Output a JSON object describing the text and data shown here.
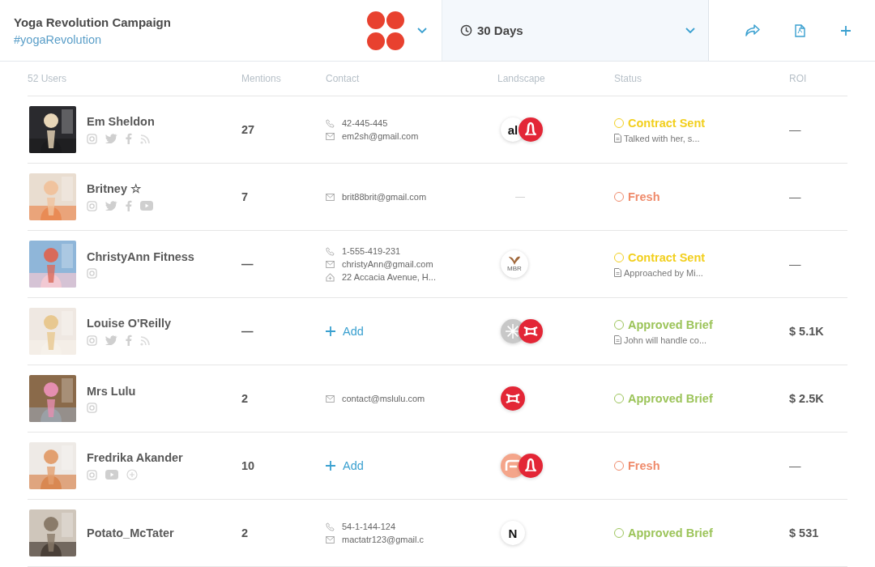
{
  "header": {
    "title": "Yoga Revolution Campaign",
    "hashtag": "#yogaRevolution",
    "date_range": "30 Days"
  },
  "columns": [
    "52 Users",
    "Mentions",
    "Contact",
    "Landscape",
    "Status",
    "ROI"
  ],
  "rows": [
    {
      "name": "Em Sheldon",
      "socials": [
        {
          "kind": "instagram"
        },
        {
          "kind": "twitter"
        },
        {
          "kind": "facebook"
        },
        {
          "kind": "rss"
        }
      ],
      "mentions": "27",
      "contact": [
        {
          "kind": "phone",
          "text": "42-445-445"
        },
        {
          "kind": "email",
          "text": "em2sh@gmail.com"
        }
      ],
      "brands": [
        {
          "kind": "wordmark",
          "text": "al"
        },
        {
          "kind": "lulu"
        }
      ],
      "status": {
        "kind": "contract",
        "label": "Contract Sent",
        "note": "Talked with her, s..."
      },
      "roi": "—"
    },
    {
      "name": "Britney ☆",
      "socials": [
        {
          "kind": "instagram"
        },
        {
          "kind": "twitter"
        },
        {
          "kind": "facebook"
        },
        {
          "kind": "youtube"
        }
      ],
      "mentions": "7",
      "contact": [
        {
          "kind": "email",
          "text": "brit88brit@gmail.com"
        }
      ],
      "brands": [],
      "brands_empty": "—",
      "status": {
        "kind": "fresh",
        "label": "Fresh"
      },
      "roi": "—"
    },
    {
      "name": "ChristyAnn Fitness",
      "socials": [
        {
          "kind": "instagram"
        }
      ],
      "mentions": "—",
      "contact": [
        {
          "kind": "phone",
          "text": "1-555-419-231"
        },
        {
          "kind": "email",
          "text": "christyAnn@gmail.com"
        },
        {
          "kind": "address",
          "text": "22 Accacia Avenue, H..."
        }
      ],
      "brands": [
        {
          "kind": "butterfly",
          "text": "MBR"
        }
      ],
      "status": {
        "kind": "contract",
        "label": "Contract Sent",
        "note": "Approached by Mi..."
      },
      "roi": "—"
    },
    {
      "name": "Louise O'Reilly",
      "socials": [
        {
          "kind": "instagram"
        },
        {
          "kind": "twitter"
        },
        {
          "kind": "facebook"
        },
        {
          "kind": "rss"
        }
      ],
      "mentions": "—",
      "contact_add": "Add",
      "contact": [],
      "brands": [
        {
          "kind": "pinwheel"
        },
        {
          "kind": "ua"
        }
      ],
      "status": {
        "kind": "approved",
        "label": "Approved Brief",
        "note": "John will handle co..."
      },
      "roi": "$ 5.1K"
    },
    {
      "name": "Mrs Lulu",
      "socials": [
        {
          "kind": "instagram"
        }
      ],
      "mentions": "2",
      "contact": [
        {
          "kind": "email",
          "text": "contact@mslulu.com"
        }
      ],
      "brands": [
        {
          "kind": "ua"
        }
      ],
      "status": {
        "kind": "approved",
        "label": "Approved Brief"
      },
      "roi": "$ 2.5K"
    },
    {
      "name": "Fredrika Akander",
      "socials": [
        {
          "kind": "instagram"
        },
        {
          "kind": "youtube"
        },
        {
          "kind": "add"
        }
      ],
      "mentions": "10",
      "contact_add": "Add",
      "contact": [],
      "brands": [
        {
          "kind": "swoosh"
        },
        {
          "kind": "lulu"
        }
      ],
      "status": {
        "kind": "fresh",
        "label": "Fresh"
      },
      "roi": "—"
    },
    {
      "name": "Potato_McTater",
      "socials": [],
      "mentions": "2",
      "contact": [
        {
          "kind": "phone",
          "text": "54-1-144-124"
        },
        {
          "kind": "email",
          "text": "mactatr123@gmail.c"
        }
      ],
      "brands": [
        {
          "kind": "wordmark",
          "text": "N"
        }
      ],
      "status": {
        "kind": "approved",
        "label": "Approved Brief"
      },
      "roi": "$ 531"
    }
  ]
}
